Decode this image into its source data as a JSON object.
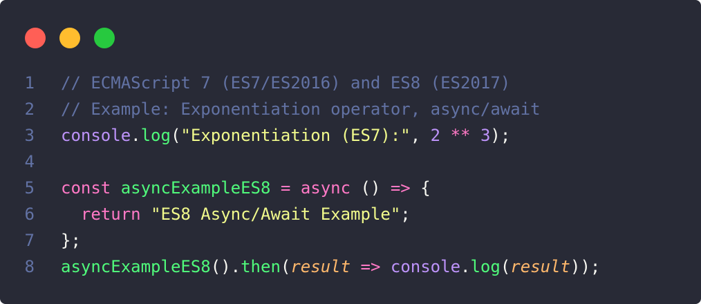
{
  "window": {
    "background": "#282a36",
    "buttons": [
      {
        "name": "close-button",
        "color": "#ff5f56"
      },
      {
        "name": "minimize-button",
        "color": "#ffbd2e"
      },
      {
        "name": "maximize-button",
        "color": "#27c93f"
      }
    ]
  },
  "colors": {
    "comment": "#6272a4",
    "plain": "#f8f8f2",
    "keyword": "#ff79c6",
    "function": "#50fa7b",
    "string": "#f1fa8c",
    "number": "#bd93f9",
    "builtin": "#bd93f9",
    "param": "#ffb86c",
    "line_number": "#6272a4"
  },
  "code": {
    "lines": [
      {
        "number": "1",
        "tokens": [
          {
            "text": "// ECMAScript 7 (ES7/ES2016) and ES8 (ES2017)",
            "kind": "comment"
          }
        ]
      },
      {
        "number": "2",
        "tokens": [
          {
            "text": "// Example: Exponentiation operator, async/await",
            "kind": "comment"
          }
        ]
      },
      {
        "number": "3",
        "tokens": [
          {
            "text": "console",
            "kind": "builtin"
          },
          {
            "text": ".",
            "kind": "plain"
          },
          {
            "text": "log",
            "kind": "function"
          },
          {
            "text": "(",
            "kind": "plain"
          },
          {
            "text": "\"Exponentiation (ES7):\"",
            "kind": "string"
          },
          {
            "text": ", ",
            "kind": "plain"
          },
          {
            "text": "2",
            "kind": "number"
          },
          {
            "text": " ",
            "kind": "plain"
          },
          {
            "text": "**",
            "kind": "keyword"
          },
          {
            "text": " ",
            "kind": "plain"
          },
          {
            "text": "3",
            "kind": "number"
          },
          {
            "text": ");",
            "kind": "plain"
          }
        ]
      },
      {
        "number": "4",
        "tokens": []
      },
      {
        "number": "5",
        "tokens": [
          {
            "text": "const",
            "kind": "keyword"
          },
          {
            "text": " ",
            "kind": "plain"
          },
          {
            "text": "asyncExampleES8",
            "kind": "function"
          },
          {
            "text": " ",
            "kind": "plain"
          },
          {
            "text": "=",
            "kind": "keyword"
          },
          {
            "text": " ",
            "kind": "plain"
          },
          {
            "text": "async",
            "kind": "keyword"
          },
          {
            "text": " () ",
            "kind": "plain"
          },
          {
            "text": "=>",
            "kind": "keyword"
          },
          {
            "text": " {",
            "kind": "plain"
          }
        ]
      },
      {
        "number": "6",
        "tokens": [
          {
            "text": "  ",
            "kind": "plain"
          },
          {
            "text": "return",
            "kind": "keyword"
          },
          {
            "text": " ",
            "kind": "plain"
          },
          {
            "text": "\"ES8 Async/Await Example\"",
            "kind": "string"
          },
          {
            "text": ";",
            "kind": "plain"
          }
        ]
      },
      {
        "number": "7",
        "tokens": [
          {
            "text": "};",
            "kind": "plain"
          }
        ]
      },
      {
        "number": "8",
        "tokens": [
          {
            "text": "asyncExampleES8",
            "kind": "function"
          },
          {
            "text": "().",
            "kind": "plain"
          },
          {
            "text": "then",
            "kind": "function"
          },
          {
            "text": "(",
            "kind": "plain"
          },
          {
            "text": "result",
            "kind": "param",
            "italic": true
          },
          {
            "text": " ",
            "kind": "plain"
          },
          {
            "text": "=>",
            "kind": "keyword"
          },
          {
            "text": " ",
            "kind": "plain"
          },
          {
            "text": "console",
            "kind": "builtin"
          },
          {
            "text": ".",
            "kind": "plain"
          },
          {
            "text": "log",
            "kind": "function"
          },
          {
            "text": "(",
            "kind": "plain"
          },
          {
            "text": "result",
            "kind": "param",
            "italic": true
          },
          {
            "text": "));",
            "kind": "plain"
          }
        ]
      }
    ]
  }
}
